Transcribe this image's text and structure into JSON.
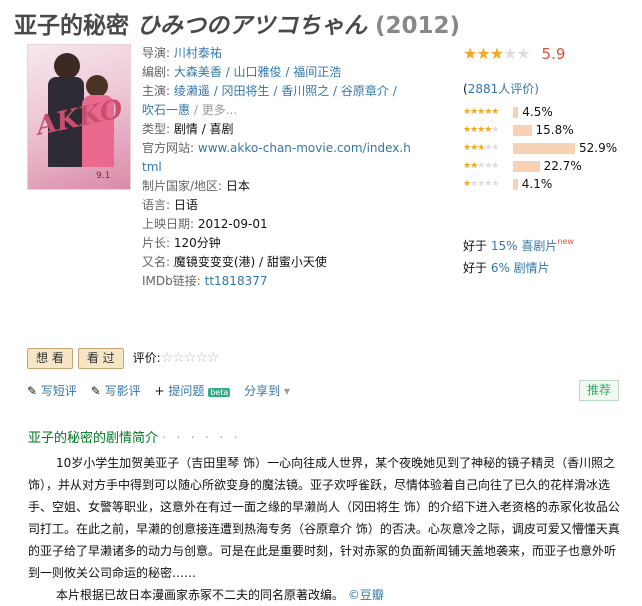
{
  "title": {
    "cn": "亚子的秘密",
    "jp": "ひみつのアツコちゃん",
    "year": "(2012)"
  },
  "poster": {
    "logo": "AKKO",
    "date": "9.1"
  },
  "info": {
    "director_label": "导演:",
    "director": "川村泰祐",
    "writer_label": "编剧:",
    "writers": "大森美香 / 山口雅俊 / 福间正浩",
    "cast_label": "主演:",
    "cast_line1": "绫濑遥 / 冈田将生 / 香川照之 / 谷原章介 /",
    "cast_line2": "吹石一惠",
    "cast_more": "/ 更多...",
    "genre_label": "类型:",
    "genre": "剧情 / 喜剧",
    "site_label": "官方网站:",
    "site_line1": "www.akko-chan-movie.com/index.h",
    "site_line2": "tml",
    "country_label": "制片国家/地区:",
    "country": "日本",
    "language_label": "语言:",
    "language": "日语",
    "release_label": "上映日期:",
    "release": "2012-09-01",
    "runtime_label": "片长:",
    "runtime": "120分钟",
    "aka_label": "又名:",
    "aka": "魔镜变变变(港) / 甜蜜小天使",
    "imdb_label": "IMDb链接:",
    "imdb": "tt1818377"
  },
  "rating": {
    "score": "5.9",
    "stars": 3,
    "votes_prefix": "(",
    "votes_count": "2881",
    "votes_suffix": "人评价)",
    "distribution": [
      {
        "stars": 5,
        "percent": 4.5,
        "label": "4.5%"
      },
      {
        "stars": 4,
        "percent": 15.8,
        "label": "15.8%"
      },
      {
        "stars": 3,
        "percent": 52.9,
        "label": "52.9%"
      },
      {
        "stars": 2,
        "percent": 22.7,
        "label": "22.7%"
      },
      {
        "stars": 1,
        "percent": 4.1,
        "label": "4.1%"
      }
    ],
    "better1_prefix": "好于 ",
    "better1_link": "15% 喜剧片",
    "better1_new": "new",
    "better2_prefix": "好于 ",
    "better2_link": "6% 剧情片"
  },
  "actions": {
    "want": "想 看",
    "seen": "看 过",
    "eval_label": "评价:",
    "eval_stars": "☆☆☆☆☆"
  },
  "tools": {
    "short_review": "写短评",
    "review": "写影评",
    "add_list": "提问题",
    "beta": "beta",
    "share": "分享到",
    "recommend": "推荐"
  },
  "synopsis": {
    "heading": "亚子的秘密的剧情简介",
    "dots": "· · · · · ·",
    "para1": "10岁小学生加贺美亚子（吉田里琴 饰）一心向往成人世界，某个夜晚她见到了神秘的镜子精灵（香川照之 饰），并从对方手中得到可以随心所欲变身的魔法镜。亚子欢呼雀跃，尽情体验着自己向往了已久的花样滑冰选手、空姐、女警等职业，这意外在有过一面之缘的早濑尚人（冈田将生 饰）的介绍下进入老资格的赤冢化妆品公司打工。在此之前，早濑的创意接连遭到热海专务（谷原章介 饰）的否决。心灰意冷之际，调皮可爱又懵懂天真的亚子给了早濑诸多的动力与创意。可是在此是重要时刻，针对赤冢的负面新闻铺天盖地袭来，而亚子也意外听到一则攸关公司命运的秘密……",
    "para2": "本片根据已故日本漫画家赤冢不二夫的同名原著改编。",
    "source": "©豆瓣"
  },
  "colors": {
    "link": "#3377aa",
    "green_heading": "#007722",
    "star": "#f5a623",
    "bar": "#f9d2b4",
    "score": "#e0503a"
  }
}
